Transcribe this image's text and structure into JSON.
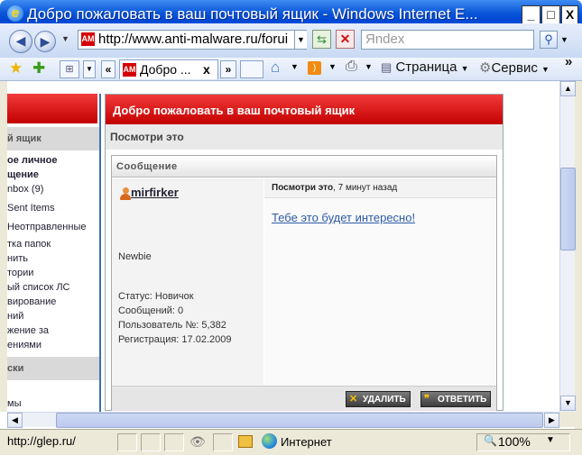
{
  "window": {
    "title": "Добро пожаловать в ваш почтовый ящик - Windows Internet E...",
    "minimize": "_",
    "maximize": "□",
    "close": "X"
  },
  "address_bar": {
    "url": "http://www.anti-malware.ru/forui",
    "favicon_text": "AM",
    "search_placeholder": "Яndex"
  },
  "tab": {
    "label": "Добро ...",
    "close": "x"
  },
  "command_bar": {
    "page_label": "Страница",
    "service_label": "Сервис",
    "more": "»"
  },
  "left_sidebar": {
    "header1": "й ящик",
    "items": [
      "ое личное",
      "щение",
      "nbox (9)",
      "Sent Items",
      "Неотправленные",
      "тка папок",
      "нить",
      "тории",
      "ый список ЛС",
      "вирование",
      "ний",
      "жение за",
      "ениями"
    ],
    "header2": "ски",
    "tail": "мы"
  },
  "panel": {
    "header": "Добро пожаловать в ваш почтовый ящик",
    "subheader": "Посмотри это",
    "message_box_title": "Сообщение",
    "author": {
      "name": "mirfirker",
      "rank": "Newbie",
      "status": "Статус: Новичок",
      "posts": "Сообщений: 0",
      "user_no": "Пользователь №: 5,382",
      "registered": "Регистрация: 17.02.2009"
    },
    "message": {
      "subject": "Посмотри это",
      "time": ", 7 минут назад",
      "link_text": "Тебе это будет интересно!"
    },
    "buttons": {
      "delete": "УДАЛИТЬ",
      "reply": "ОТВЕТИТЬ"
    }
  },
  "status_bar": {
    "url": "http://glep.ru/",
    "zone": "Интернет",
    "zoom": "100%"
  }
}
